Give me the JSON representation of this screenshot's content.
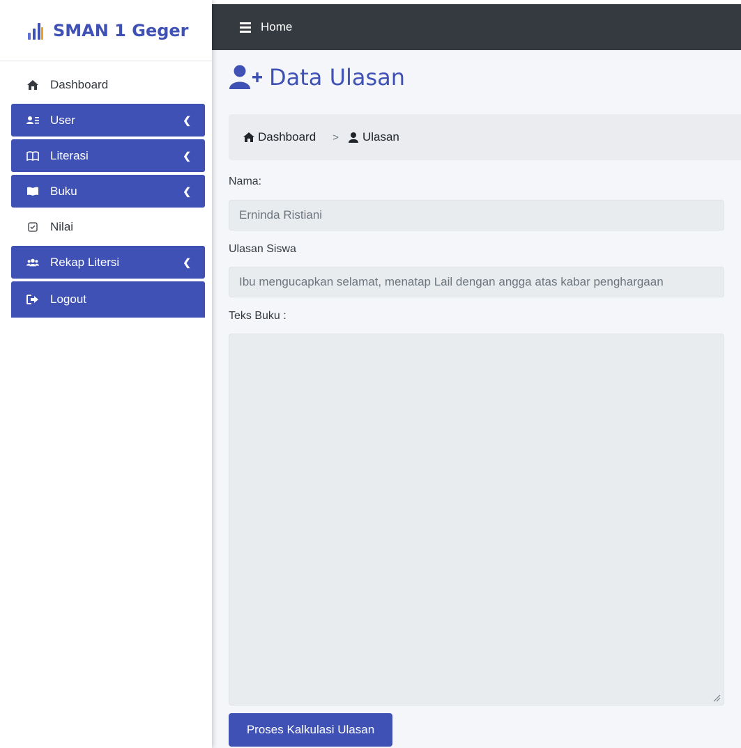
{
  "brand": {
    "name": "SMAN 1 Geger",
    "color": "#3f51b5"
  },
  "sidebar": {
    "items": [
      {
        "label": "Dashboard",
        "icon": "home-icon",
        "active": false
      },
      {
        "label": "User",
        "icon": "user-list-icon",
        "active": true,
        "has_submenu": true
      },
      {
        "label": "Literasi",
        "icon": "open-book-icon",
        "active": true,
        "has_submenu": true
      },
      {
        "label": "Buku",
        "icon": "book-icon",
        "active": true,
        "has_submenu": true
      },
      {
        "label": "Nilai",
        "icon": "checkbox-icon",
        "active": false
      },
      {
        "label": "Rekap Litersi",
        "icon": "users-group-icon",
        "active": true,
        "has_submenu": true
      },
      {
        "label": "Logout",
        "icon": "sign-out-icon",
        "active": true
      }
    ]
  },
  "topbar": {
    "menu_icon": "hamburger-icon",
    "home_label": "Home"
  },
  "page": {
    "title": "Data Ulasan",
    "title_icon": "user-plus-icon"
  },
  "breadcrumb": {
    "items": [
      {
        "label": "Dashboard",
        "icon": "home-icon"
      },
      {
        "label": "Ulasan",
        "icon": "user-icon"
      }
    ],
    "separator": ">"
  },
  "form": {
    "nama_label": "Nama:",
    "nama_value": "Erninda Ristiani",
    "ulasan_label": "Ulasan Siswa",
    "ulasan_value": "Ibu mengucapkan selamat, menatap Lail dengan angga atas kabar penghargaan",
    "teks_label": "Teks Buku :",
    "teks_value": "",
    "submit_label": "Proses Kalkulasi Ulasan"
  },
  "colors": {
    "accent": "#3f51b5",
    "navbar": "#343a40",
    "content_bg": "#f4f6f9",
    "field_bg": "#e9ecef"
  }
}
